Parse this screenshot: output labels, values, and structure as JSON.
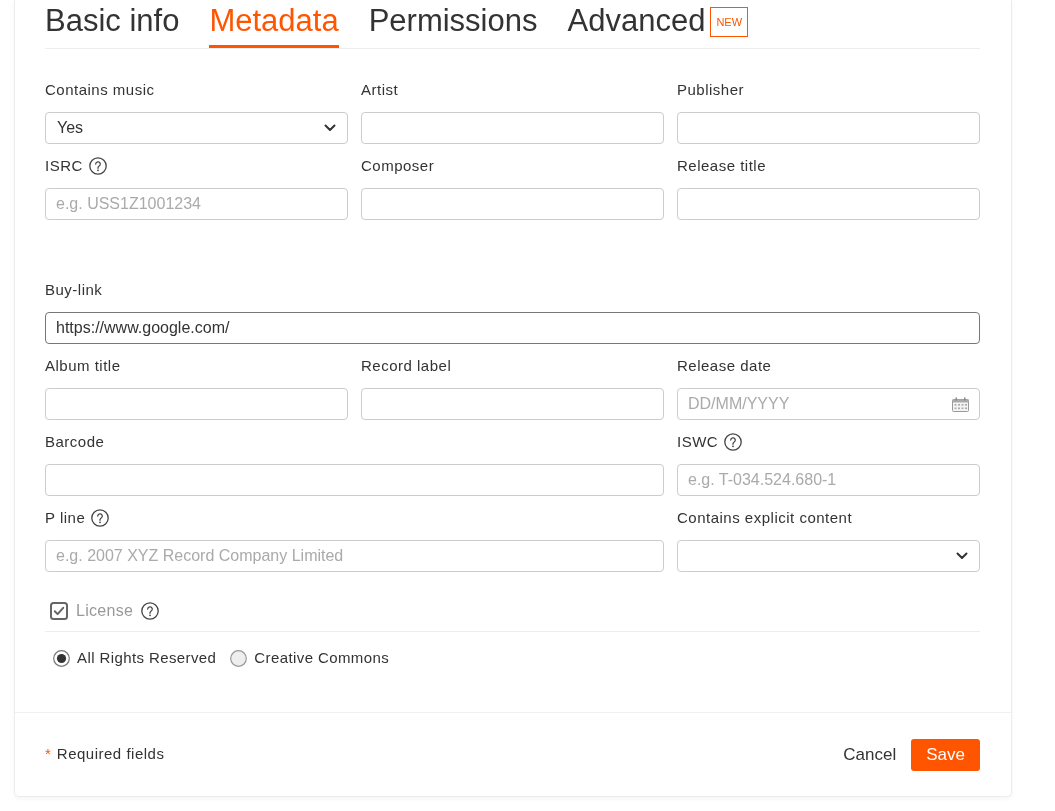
{
  "tabs": [
    {
      "label": "Basic info",
      "selected": false
    },
    {
      "label": "Metadata",
      "selected": true
    },
    {
      "label": "Permissions",
      "selected": false
    },
    {
      "label": "Advanced",
      "selected": false,
      "badge": "NEW"
    }
  ],
  "sections": [
    {
      "rows": [
        {
          "fields": [
            {
              "label": "Contains music",
              "kind": "select",
              "value": "Yes",
              "help": false,
              "focused": false
            },
            {
              "label": "Artist",
              "kind": "text",
              "help": false,
              "focused": false
            },
            {
              "label": "Publisher",
              "kind": "text",
              "help": false,
              "focused": false
            }
          ]
        },
        {
          "fields": [
            {
              "label": "ISRC",
              "kind": "text",
              "placeholder": "e.g. USS1Z1001234",
              "help": true,
              "focused": false
            },
            {
              "label": "Composer",
              "kind": "text",
              "help": false,
              "focused": false
            },
            {
              "label": "Release title",
              "kind": "text",
              "help": false,
              "focused": false
            }
          ]
        }
      ]
    },
    {
      "rows": [
        {
          "fields": [
            {
              "label": "Buy-link",
              "kind": "text",
              "value": "https://www.google.com/",
              "help": false,
              "focused": true
            }
          ]
        },
        {
          "fields": [
            {
              "label": "Album title",
              "kind": "text",
              "help": false,
              "focused": false
            },
            {
              "label": "Record label",
              "kind": "text",
              "help": false,
              "focused": false
            },
            {
              "label": "Release date",
              "kind": "date",
              "placeholder": "DD/MM/YYYY",
              "help": false,
              "focused": false
            }
          ]
        },
        {
          "fields": [
            {
              "label": "Barcode",
              "kind": "text",
              "help": false,
              "focused": false
            },
            {
              "label": "ISWC",
              "kind": "text",
              "placeholder": "e.g. T-034.524.680-1",
              "help": true,
              "focused": false
            }
          ]
        },
        {
          "fields": [
            {
              "label": "P line",
              "kind": "text",
              "placeholder": "e.g. 2007 XYZ Record Company Limited",
              "help": true,
              "focused": false
            },
            {
              "label": "Contains explicit content",
              "kind": "select",
              "help": false,
              "focused": false
            }
          ]
        }
      ]
    }
  ],
  "license": {
    "label": "License",
    "checked": true,
    "disabled": true,
    "help": true
  },
  "license_options": [
    {
      "label": "All Rights Reserved",
      "selected": true
    },
    {
      "label": "Creative Commons",
      "selected": false
    }
  ],
  "footer": {
    "required_marker": "*",
    "required_note": "Required fields",
    "buttons": [
      {
        "label": "Cancel",
        "kind": "link"
      },
      {
        "label": "Save",
        "kind": "primary"
      }
    ]
  }
}
